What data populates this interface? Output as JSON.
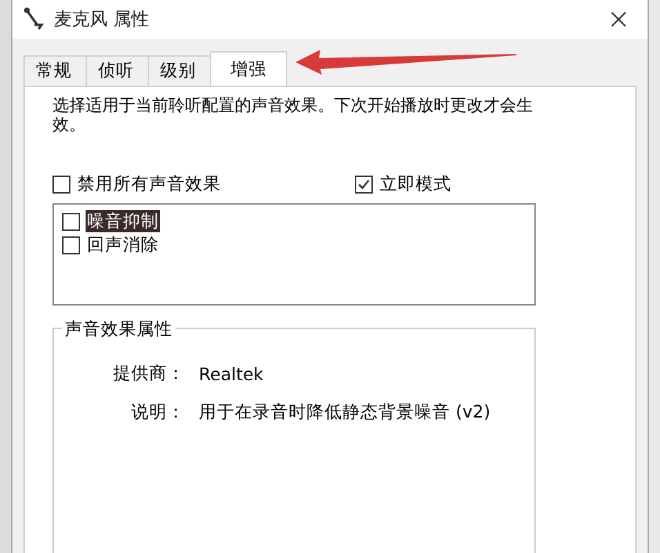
{
  "window": {
    "title": "麦克风 属性"
  },
  "tabs": [
    {
      "label": "常规",
      "selected": false
    },
    {
      "label": "侦听",
      "selected": false
    },
    {
      "label": "级别",
      "selected": false
    },
    {
      "label": "增强",
      "selected": true
    }
  ],
  "intro": "选择适用于当前聆听配置的声音效果。下次开始播放时更改才会生效。",
  "disable_all": {
    "label": "禁用所有声音效果",
    "checked": false
  },
  "immediate_mode": {
    "label": "立即模式",
    "checked": true
  },
  "effects": [
    {
      "label": "噪音抑制",
      "checked": false,
      "selected": true
    },
    {
      "label": "回声消除",
      "checked": false,
      "selected": false
    }
  ],
  "properties": {
    "title": "声音效果属性",
    "rows": [
      {
        "label": "提供商：",
        "value": "Realtek"
      },
      {
        "label": "说明：",
        "value": "用于在录音时降低静态背景噪音 (v2)"
      }
    ]
  }
}
